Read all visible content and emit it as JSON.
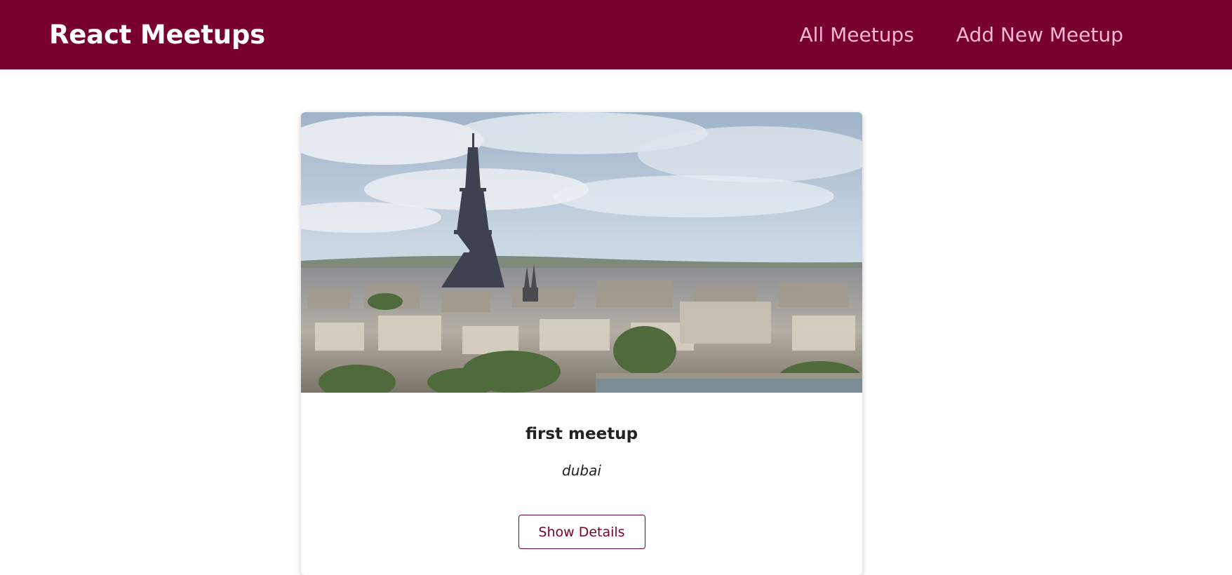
{
  "header": {
    "logo": "React Meetups",
    "nav": [
      {
        "label": "All Meetups"
      },
      {
        "label": "Add New Meetup"
      }
    ]
  },
  "meetup": {
    "title": "first meetup",
    "address": "dubai",
    "action_label": "Show Details"
  },
  "colors": {
    "brand": "#77002e",
    "nav_link": "#fcb8d2"
  }
}
